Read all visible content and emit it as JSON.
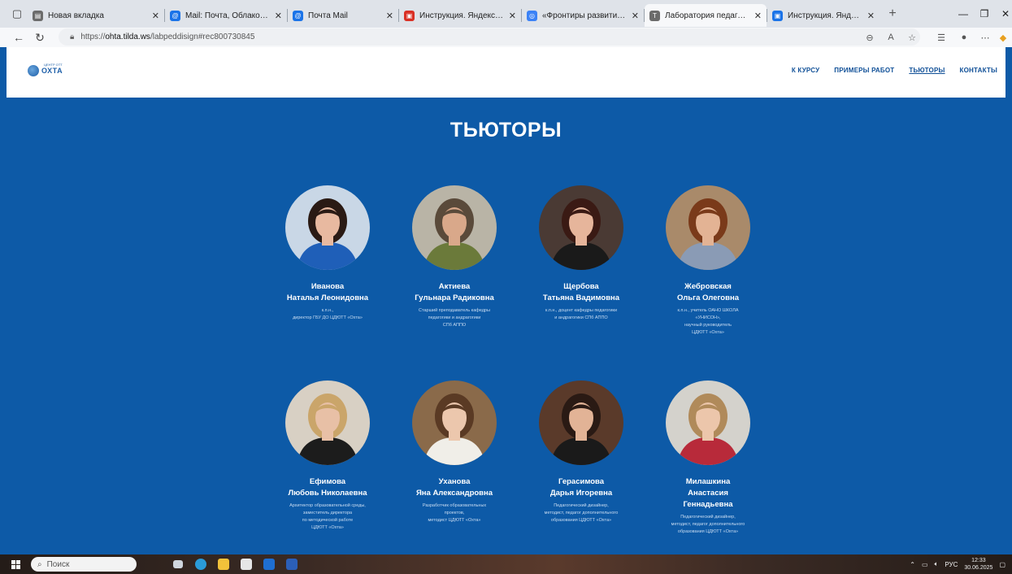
{
  "browser": {
    "tabs": [
      {
        "title": "Новая вкладка",
        "fav_color": "#6b6b6b",
        "fav_glyph": "▤",
        "active": false
      },
      {
        "title": "Mail: Почта, Облако, Календарь",
        "fav_color": "#1a73e8",
        "fav_glyph": "@",
        "active": false
      },
      {
        "title": "Почта Mail",
        "fav_color": "#1a73e8",
        "fav_glyph": "@",
        "active": false
      },
      {
        "title": "Инструкция. Яндекс Формы.pdf",
        "fav_color": "#d93025",
        "fav_glyph": "▣",
        "active": false
      },
      {
        "title": "«Фронтиры развития методичес",
        "fav_color": "#3b82f6",
        "fav_glyph": "◎",
        "active": false
      },
      {
        "title": "Лаборатория педагогического",
        "fav_color": "#6b6b6b",
        "fav_glyph": "T",
        "active": true
      },
      {
        "title": "Инструкция. Яндекс Формы.pdf",
        "fav_color": "#1a73e8",
        "fav_glyph": "▣",
        "active": false
      }
    ],
    "url_prefix": "https://",
    "url_host": "ohta.tilda.ws",
    "url_path": "/labpeddisign#rec800730845"
  },
  "site": {
    "logo_text": "ОХТА",
    "logo_small": "ЦЕНТР ОТТ",
    "menu": [
      {
        "label": "К КУРСУ",
        "current": false
      },
      {
        "label": "ПРИМЕРЫ РАБОТ",
        "current": false
      },
      {
        "label": "ТЬЮТОРЫ",
        "current": true
      },
      {
        "label": "КОНТАКТЫ",
        "current": false
      }
    ]
  },
  "section": {
    "title": "ТЬЮТОРЫ"
  },
  "tutors": [
    {
      "surname": "Иванова",
      "given": "Наталья Леонидовна",
      "desc": "к.п.н.,\nдиректор ГБУ ДО ЦДЮТТ «Охта»",
      "photo": {
        "bg": "#c9d7e6",
        "hair": "#2a1a14",
        "skin": "#e8b9a0",
        "cloth": "#1f5fb8"
      }
    },
    {
      "surname": "Актиева",
      "given": "Гульнара Радиковна",
      "desc": "Старший преподаватель кафедры\nпедагогики и андрагогики\nСПб АППО",
      "photo": {
        "bg": "#b9b4a6",
        "hair": "#5a4a3a",
        "skin": "#d9a88a",
        "cloth": "#6b7a3a"
      }
    },
    {
      "surname": "Щербова",
      "given": "Татьяна Вадимовна",
      "desc": "к.п.н., доцент кафедры педагогики\nи андрагогики СПб АППО",
      "photo": {
        "bg": "#4a3a34",
        "hair": "#3a1a14",
        "skin": "#e6b59b",
        "cloth": "#1a1a1a"
      }
    },
    {
      "surname": "Жебровская",
      "given": "Ольга Олеговна",
      "desc": "к.п.н., учитель ОАНО ШКОЛА\n«УНИСОН»,\nнаучный руководитель\nЦДЮТТ «Охта»",
      "photo": {
        "bg": "#a98a6a",
        "hair": "#7a3a1a",
        "skin": "#e3b394",
        "cloth": "#8a9bb5"
      }
    },
    {
      "surname": "Ефимова",
      "given": "Любовь Николаевна",
      "desc": "Архитектор образовательной среды,\nзаместитель директора\nпо методической работе\nЦДЮТТ «Охта»",
      "photo": {
        "bg": "#d8d0c4",
        "hair": "#caa56a",
        "skin": "#e8c0a6",
        "cloth": "#1c1c1c"
      }
    },
    {
      "surname": "Уханова",
      "given": "Яна Александровна",
      "desc": "Разработчик образовательных\nпроектов,\nметодист ЦДЮТТ «Охта»",
      "photo": {
        "bg": "#8a6a4a",
        "hair": "#5a3a24",
        "skin": "#ecc7ad",
        "cloth": "#f0eee8"
      }
    },
    {
      "surname": "Герасимова",
      "given": "Дарья Игоревна",
      "desc": "Педагогический дизайнер,\nметодист, педагог дополнительного\nобразования ЦДЮТТ «Охта»",
      "photo": {
        "bg": "#5a3a2a",
        "hair": "#2a1a14",
        "skin": "#e2b396",
        "cloth": "#1a1a1a"
      }
    },
    {
      "surname": "Милашкина",
      "given": "Анастасия\nГеннадьевна",
      "desc": "Педагогический дизайнер,\nметодист, педагог дополнительного\nобразования ЦДЮТТ «Охта»",
      "photo": {
        "bg": "#d4d2cc",
        "hair": "#b08a5a",
        "skin": "#ecc6ab",
        "cloth": "#b82a3a"
      }
    }
  ],
  "taskbar": {
    "search_placeholder": "Поиск",
    "lang": "РУС",
    "time": "12:33",
    "date": "30.06.2025"
  }
}
